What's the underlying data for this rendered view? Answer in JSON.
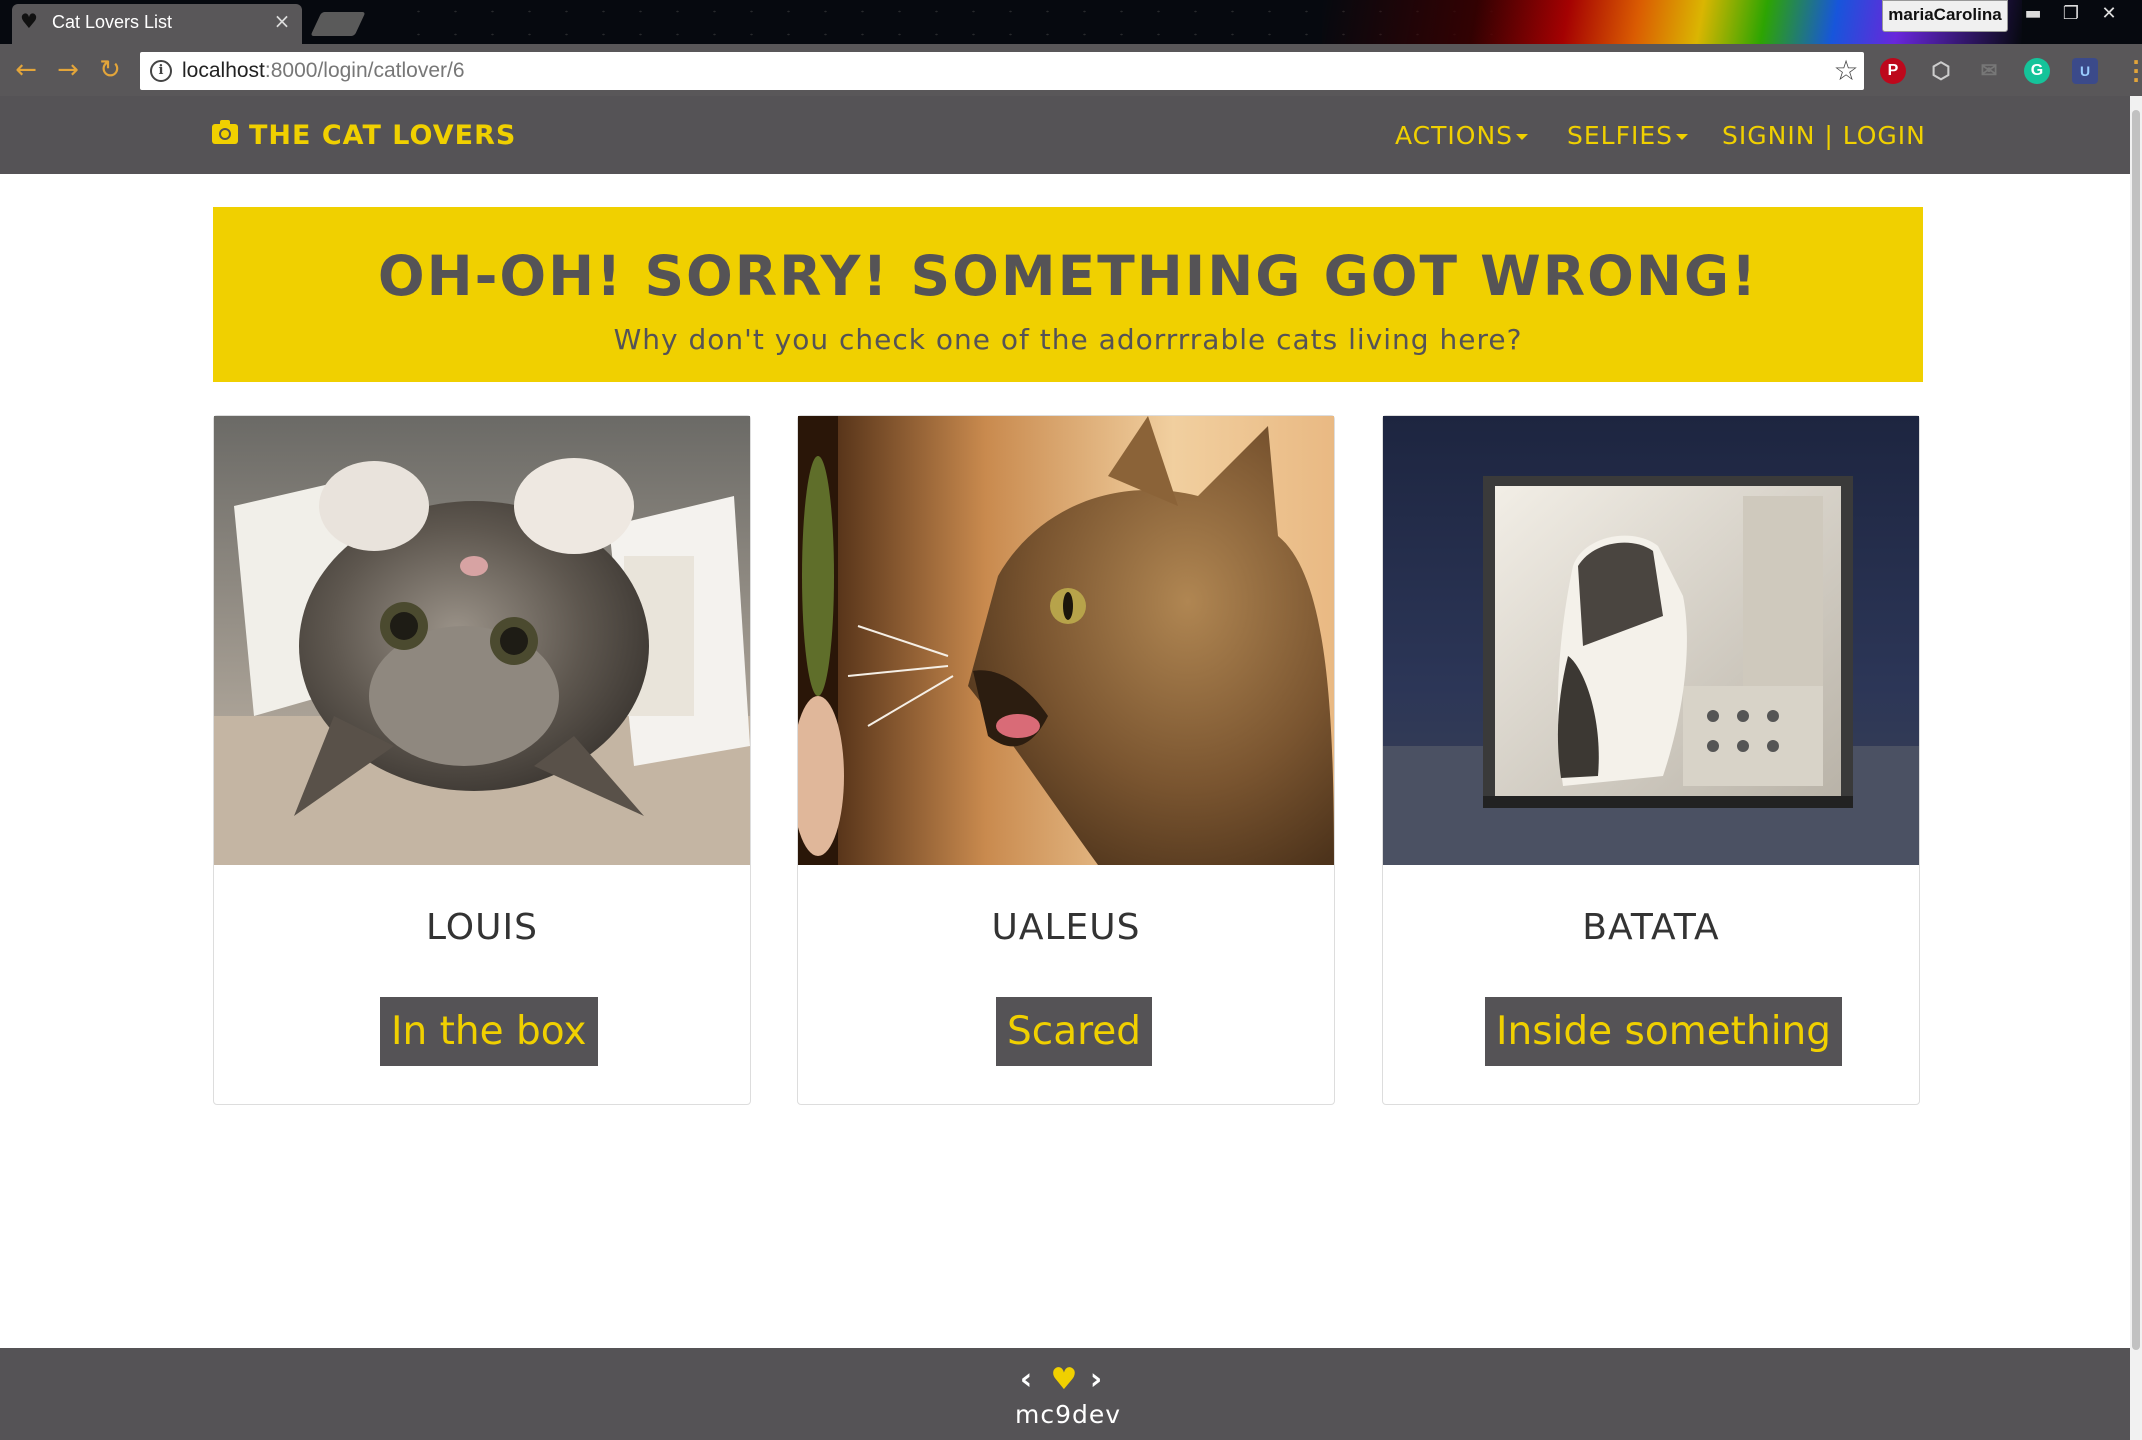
{
  "browser": {
    "tab_title": "Cat Lovers List",
    "profile_name": "mariaCarolina",
    "url_host": "localhost",
    "url_path": ":8000/login/catlover/6",
    "extensions": [
      "pinterest-icon",
      "dropbox-icon",
      "inbox-icon",
      "grammarly-icon",
      "ublock-icon"
    ]
  },
  "navbar": {
    "brand": "THE CAT LOVERS",
    "actions_label": "ACTIONS",
    "selfies_label": "SELFIES",
    "auth_label": "SIGNIN | LOGIN"
  },
  "hero": {
    "title": "OH-OH! SORRY! SOMETHING GOT WRONG!",
    "subtitle": "Why don't you check one of the adorrrrable cats living here?"
  },
  "cats": [
    {
      "name": "LOUIS",
      "tag": "In the box",
      "photo": "kitten-in-box"
    },
    {
      "name": "UALEUS",
      "tag": "Scared",
      "photo": "tabby-cat-scared"
    },
    {
      "name": "BATATA",
      "tag": "Inside something",
      "photo": "cat-inside-computer-case"
    }
  ],
  "footer": {
    "credit": "mc9dev"
  },
  "colors": {
    "brand_yellow": "#f0d000",
    "navbar_gray": "#555356",
    "text_gray": "#333333"
  }
}
